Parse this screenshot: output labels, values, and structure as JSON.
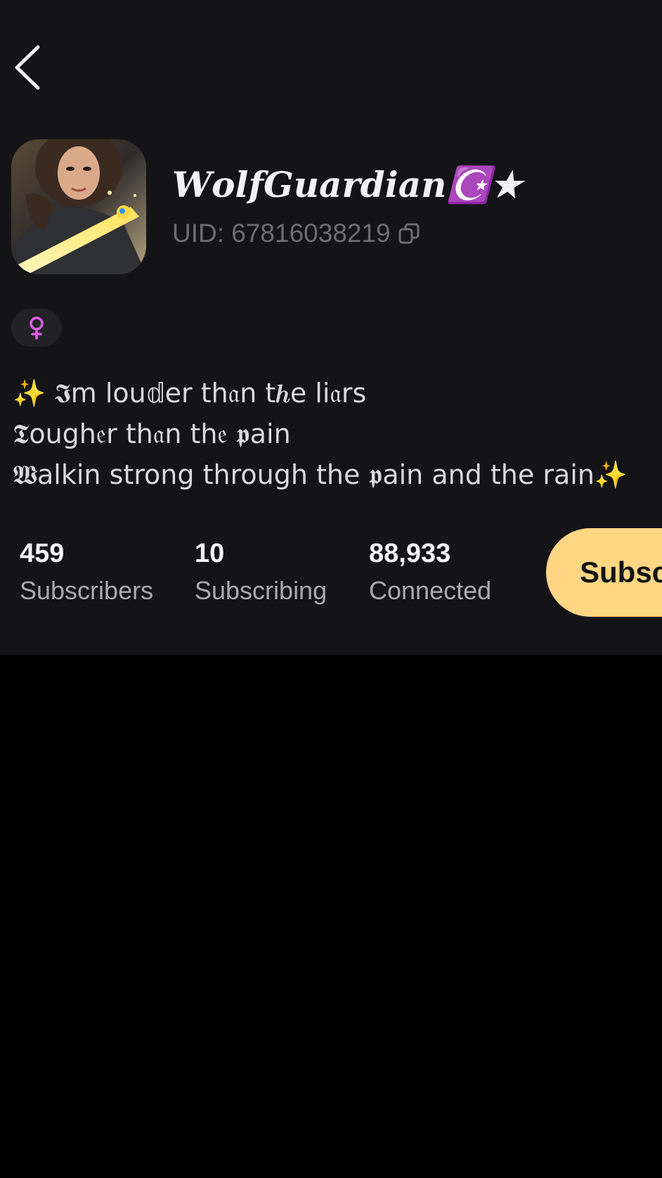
{
  "header": {
    "back_icon": "chevron-left-icon"
  },
  "profile": {
    "display_name": "𝑾𝒐𝒍𝒇𝑮𝒖𝒂𝒓𝒅𝒊𝒂𝒏☪️★",
    "uid_text": "UID: 67816038219",
    "copy_icon": "copy-icon",
    "gender_icon": "female-symbol-icon",
    "gender_color": "#e05ce6",
    "avatar": "avatar-image"
  },
  "bio": {
    "lines": [
      "✨ 𝕴m lou𝕕er th𝔞n t𝒉e li𝔞rs",
      "𝕿ough𝔢r th𝔞n th𝔢 𝖕ain",
      "𝖂alkin strong through the 𝖕ain and the rain✨"
    ]
  },
  "stats": [
    {
      "value": "459",
      "label": "Subscribers"
    },
    {
      "value": "10",
      "label": "Subscribing"
    },
    {
      "value": "88,933",
      "label": "Connected"
    }
  ],
  "actions": {
    "subscribe_label": "Subscribe"
  },
  "colors": {
    "panel_background": "#141417",
    "page_background": "#000000",
    "accent": "#fed684"
  }
}
